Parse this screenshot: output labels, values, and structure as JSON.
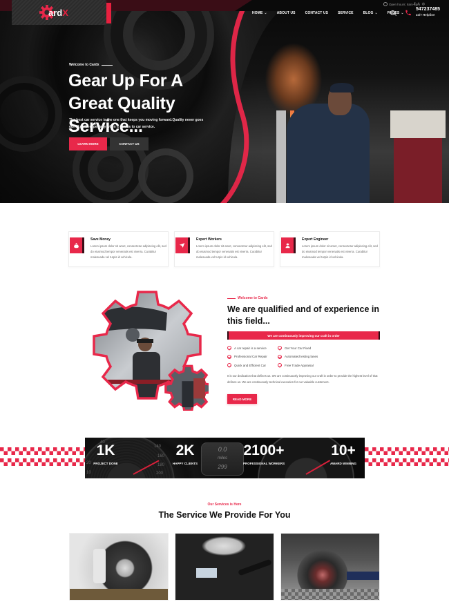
{
  "brand": {
    "logo_text": "ard",
    "logo_suffix": "X",
    "accent": "#e8284a",
    "dark_accent": "#3a0d16"
  },
  "topbar": {
    "open_hours": "Open hours: 8am-6pm",
    "social_icons": [
      "facebook-icon",
      "twitter-icon",
      "instagram-icon"
    ]
  },
  "nav": {
    "items": [
      {
        "label": "HOME",
        "has_dropdown": true
      },
      {
        "label": "ABOUT US",
        "has_dropdown": false
      },
      {
        "label": "CONTACT US",
        "has_dropdown": false
      },
      {
        "label": "SERVICE",
        "has_dropdown": false
      },
      {
        "label": "BLOG",
        "has_dropdown": true
      },
      {
        "label": "PAGES",
        "has_dropdown": true
      }
    ],
    "chevron": "⌄",
    "phone_number": "547237485",
    "phone_label": "24/7 Helpline"
  },
  "hero": {
    "kicker": "Welcome to Cardx",
    "title": "Gear Up For A Great Quality Service...",
    "description": "The best car service is the one that keeps you moving forward.Quality never goes out of style, especially when it comes to car service.",
    "primary_button": "LEARN MORE",
    "secondary_button": "CONTACT US"
  },
  "features": [
    {
      "icon": "money-bag-icon",
      "title": "Save Money",
      "description": "Lorem ipsum dolor sit amet, consectetur adipiscing elit, sed do eiusmod tempor venenatis est viverra. Curabitur malesuada vel turpis id vehicula."
    },
    {
      "icon": "paper-plane-icon",
      "title": "Expert Workers",
      "description": "Lorem ipsum dolor sit amet, consectetur adipiscing elit, sed do eiusmod tempor venenatis est viverra. Curabitur malesuada vel turpis id vehicula."
    },
    {
      "icon": "engineer-icon",
      "title": "Expert Engineer",
      "description": "Lorem ipsum dolor sit amet, consectetur adipiscing elit, sed do eiusmod tempor venenatis est viverra. Curabitur malesuada vel turpis id vehicula."
    }
  ],
  "about": {
    "kicker": "Welcome to Cardx",
    "title": "We are qualified and of experience in this field...",
    "banner": "We are continuously improving our craft in order",
    "checklist": [
      "A car repair is a service",
      "Get Your Car Fixed",
      "Professional Car Repair",
      "Automated testing lanes",
      "Quick and Efficient Car",
      "Free Trade Appraisal"
    ],
    "description": "It is our dedication that defines us. We are continuously improving our craft in order to provide the highest level of that defines us. We are continuously technical execution for our valuable customers.",
    "button": "READ MORE"
  },
  "counters": [
    {
      "value": "1K",
      "label": "PROJECT DONE"
    },
    {
      "value": "2K",
      "label": "HAPPY CLIENTS"
    },
    {
      "value": "2100+",
      "label": "PROFESSIONAL WORKERS"
    },
    {
      "value": "10+",
      "label": "AWARD WINNING"
    }
  ],
  "odometer": {
    "top": "0.0",
    "unit": "miles",
    "bottom": "299"
  },
  "dial_ticks": [
    "40",
    "20",
    "10",
    "140",
    "160",
    "180",
    "200"
  ],
  "services": {
    "kicker": "Our Services is Here",
    "title": "The Service We Provide For You",
    "cards": [
      {
        "image": "brake-disc-photo"
      },
      {
        "image": "engine-bay-photo"
      },
      {
        "image": "race-car-wheel-photo"
      }
    ]
  }
}
